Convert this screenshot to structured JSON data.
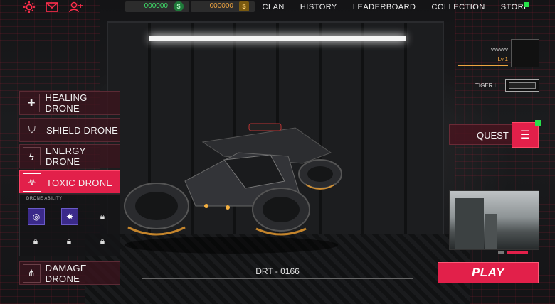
{
  "topbar": {
    "currency_green": "000000",
    "currency_gold": "000000",
    "nav": [
      "CLAN",
      "HISTORY",
      "LEADERBOARD",
      "COLLECTION",
      "STORE"
    ]
  },
  "drones": [
    {
      "label": "HEALING DRONE",
      "icon": "healing-icon",
      "active": false
    },
    {
      "label": "SHIELD DRONE",
      "icon": "shield-icon",
      "active": false
    },
    {
      "label": "ENERGY DRONE",
      "icon": "energy-icon",
      "active": false
    },
    {
      "label": "TOXIC DRONE",
      "icon": "toxic-icon",
      "active": true
    }
  ],
  "ability": {
    "title": "DRONE ABILITY",
    "slots": [
      {
        "state": "unlocked",
        "icon": "ability-swirl-icon"
      },
      {
        "state": "unlocked",
        "icon": "ability-splat-icon"
      },
      {
        "state": "locked",
        "icon": "lock-icon"
      },
      {
        "state": "locked",
        "icon": "lock-icon"
      },
      {
        "state": "locked",
        "icon": "lock-icon"
      },
      {
        "state": "locked",
        "icon": "lock-icon"
      }
    ]
  },
  "damage_drone": {
    "label": "DAMAGE DRONE"
  },
  "profile": {
    "name": "vvvvvv",
    "level": "Lv.1"
  },
  "rank": {
    "label": "TIGER I"
  },
  "quest": {
    "label": "QUEST"
  },
  "model": {
    "name": "DRT - 0166"
  },
  "play": {
    "label": "PLAY"
  },
  "colors": {
    "accent": "#e2204a",
    "gold": "#f0a540",
    "green": "#27e04a"
  }
}
